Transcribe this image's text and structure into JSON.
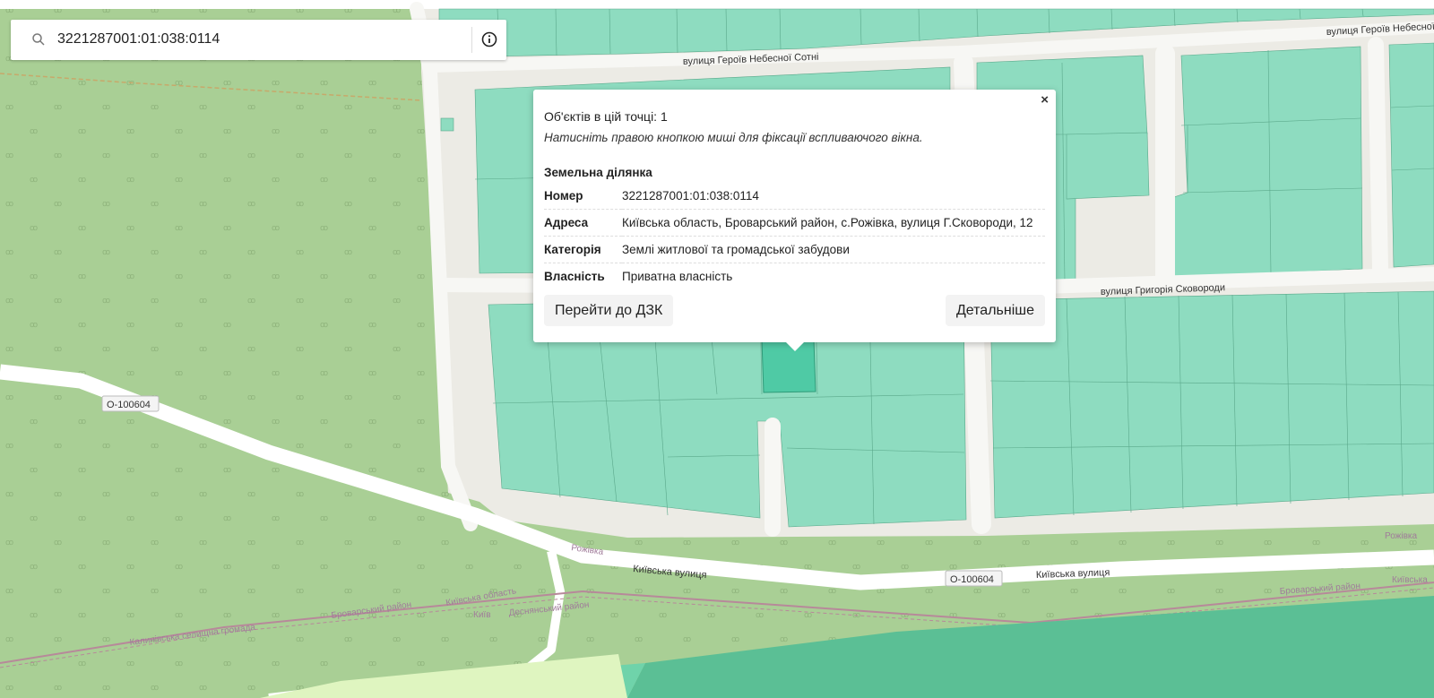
{
  "search": {
    "value": "3221287001:01:038:0114",
    "icon": "search-icon",
    "info_icon": "info-icon"
  },
  "map_labels": {
    "street_heroes_top": "вулиця Героїв Небесної Сотні",
    "street_heroes_right": "вулиця Героїв Небесної",
    "street_skovorody": "вулиця Григорія Сковороди",
    "road_code_1": "О-100604",
    "road_code_2": "О-100604",
    "kyivska_street_1": "Київська вулиця",
    "kyivska_street_2": "Київська вулиця",
    "rozhivka_1": "Рожівка",
    "rozhivka_2": "Рожівка",
    "brovary_district_1": "Броварський район",
    "brovary_district_2": "Броварський район",
    "kyiv_oblast_1": "Київська область",
    "kyiv_oblast_2": "Київська",
    "kyiv": "Київ",
    "desnianskyi": "Деснянський район",
    "kalynivka": "Калинівська селищна громада"
  },
  "popup": {
    "close": "×",
    "count_text": "Об'єктів в цій точці: 1",
    "hint": "Натисніть правою кнопкою миші для фіксації вспливаючого вікна.",
    "section_title": "Земельна ділянка",
    "rows": [
      {
        "key": "Номер",
        "value": "3221287001:01:038:0114"
      },
      {
        "key": "Адреса",
        "value": "Київська область, Броварський район, с.Рожівка, вулиця Г.Сковороди, 12"
      },
      {
        "key": "Категорія",
        "value": "Землі житлової та громадської забудови"
      },
      {
        "key": "Власність",
        "value": "Приватна власність"
      }
    ],
    "btn_dzk": "Перейти до ДЗК",
    "btn_details": "Детальніше"
  },
  "colors": {
    "forest": "#a9cf95",
    "parcel": "#8edcc0",
    "parcel_selected": "#4fcaa5",
    "road": "#f4f4f0",
    "urban": "#ecebe5"
  }
}
